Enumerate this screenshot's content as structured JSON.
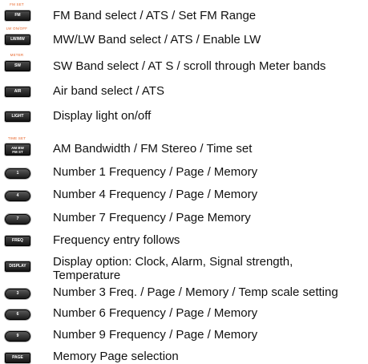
{
  "rows": [
    {
      "sup": "FM SET",
      "key": "FM",
      "text": "FM Band select / ATS / Set FM Range"
    },
    {
      "sup": "LW ON/OFF",
      "key": "LW/MW",
      "text": "MW/LW Band select / ATS / Enable LW"
    },
    {
      "sup": "METER",
      "key": "SW",
      "text": "SW Band select / AT S / scroll through Meter bands"
    },
    {
      "key": "AIR",
      "text": "Air band select / ATS"
    },
    {
      "key": "LIGHT",
      "text": "Display light on/off"
    },
    {
      "sup": "TIME SET",
      "key_line1": "AM BW",
      "key_line2": "FM ST",
      "text": "AM Bandwidth / FM Stereo / Time set"
    },
    {
      "key": "1",
      "text": "Number 1 Frequency / Page / Memory"
    },
    {
      "key": "4",
      "text": "Number 4 Frequency / Page / Memory"
    },
    {
      "key": "7",
      "text": "Number 7 Frequency / Page Memory"
    },
    {
      "key": "FREQ",
      "text": "Frequency entry follows"
    },
    {
      "key": "DISPLAY",
      "text_line1": "Display option: Clock, Alarm, Signal strength,",
      "text_line2": "Temperature"
    },
    {
      "key": "3",
      "text": "Number 3 Freq. / Page / Memory / Temp scale setting"
    },
    {
      "key": "6",
      "text": "Number 6 Frequency / Page / Memory"
    },
    {
      "key": "9",
      "text": "Number 9 Frequency / Page / Memory"
    },
    {
      "key": "PAGE",
      "text": "Memory Page selection"
    }
  ]
}
